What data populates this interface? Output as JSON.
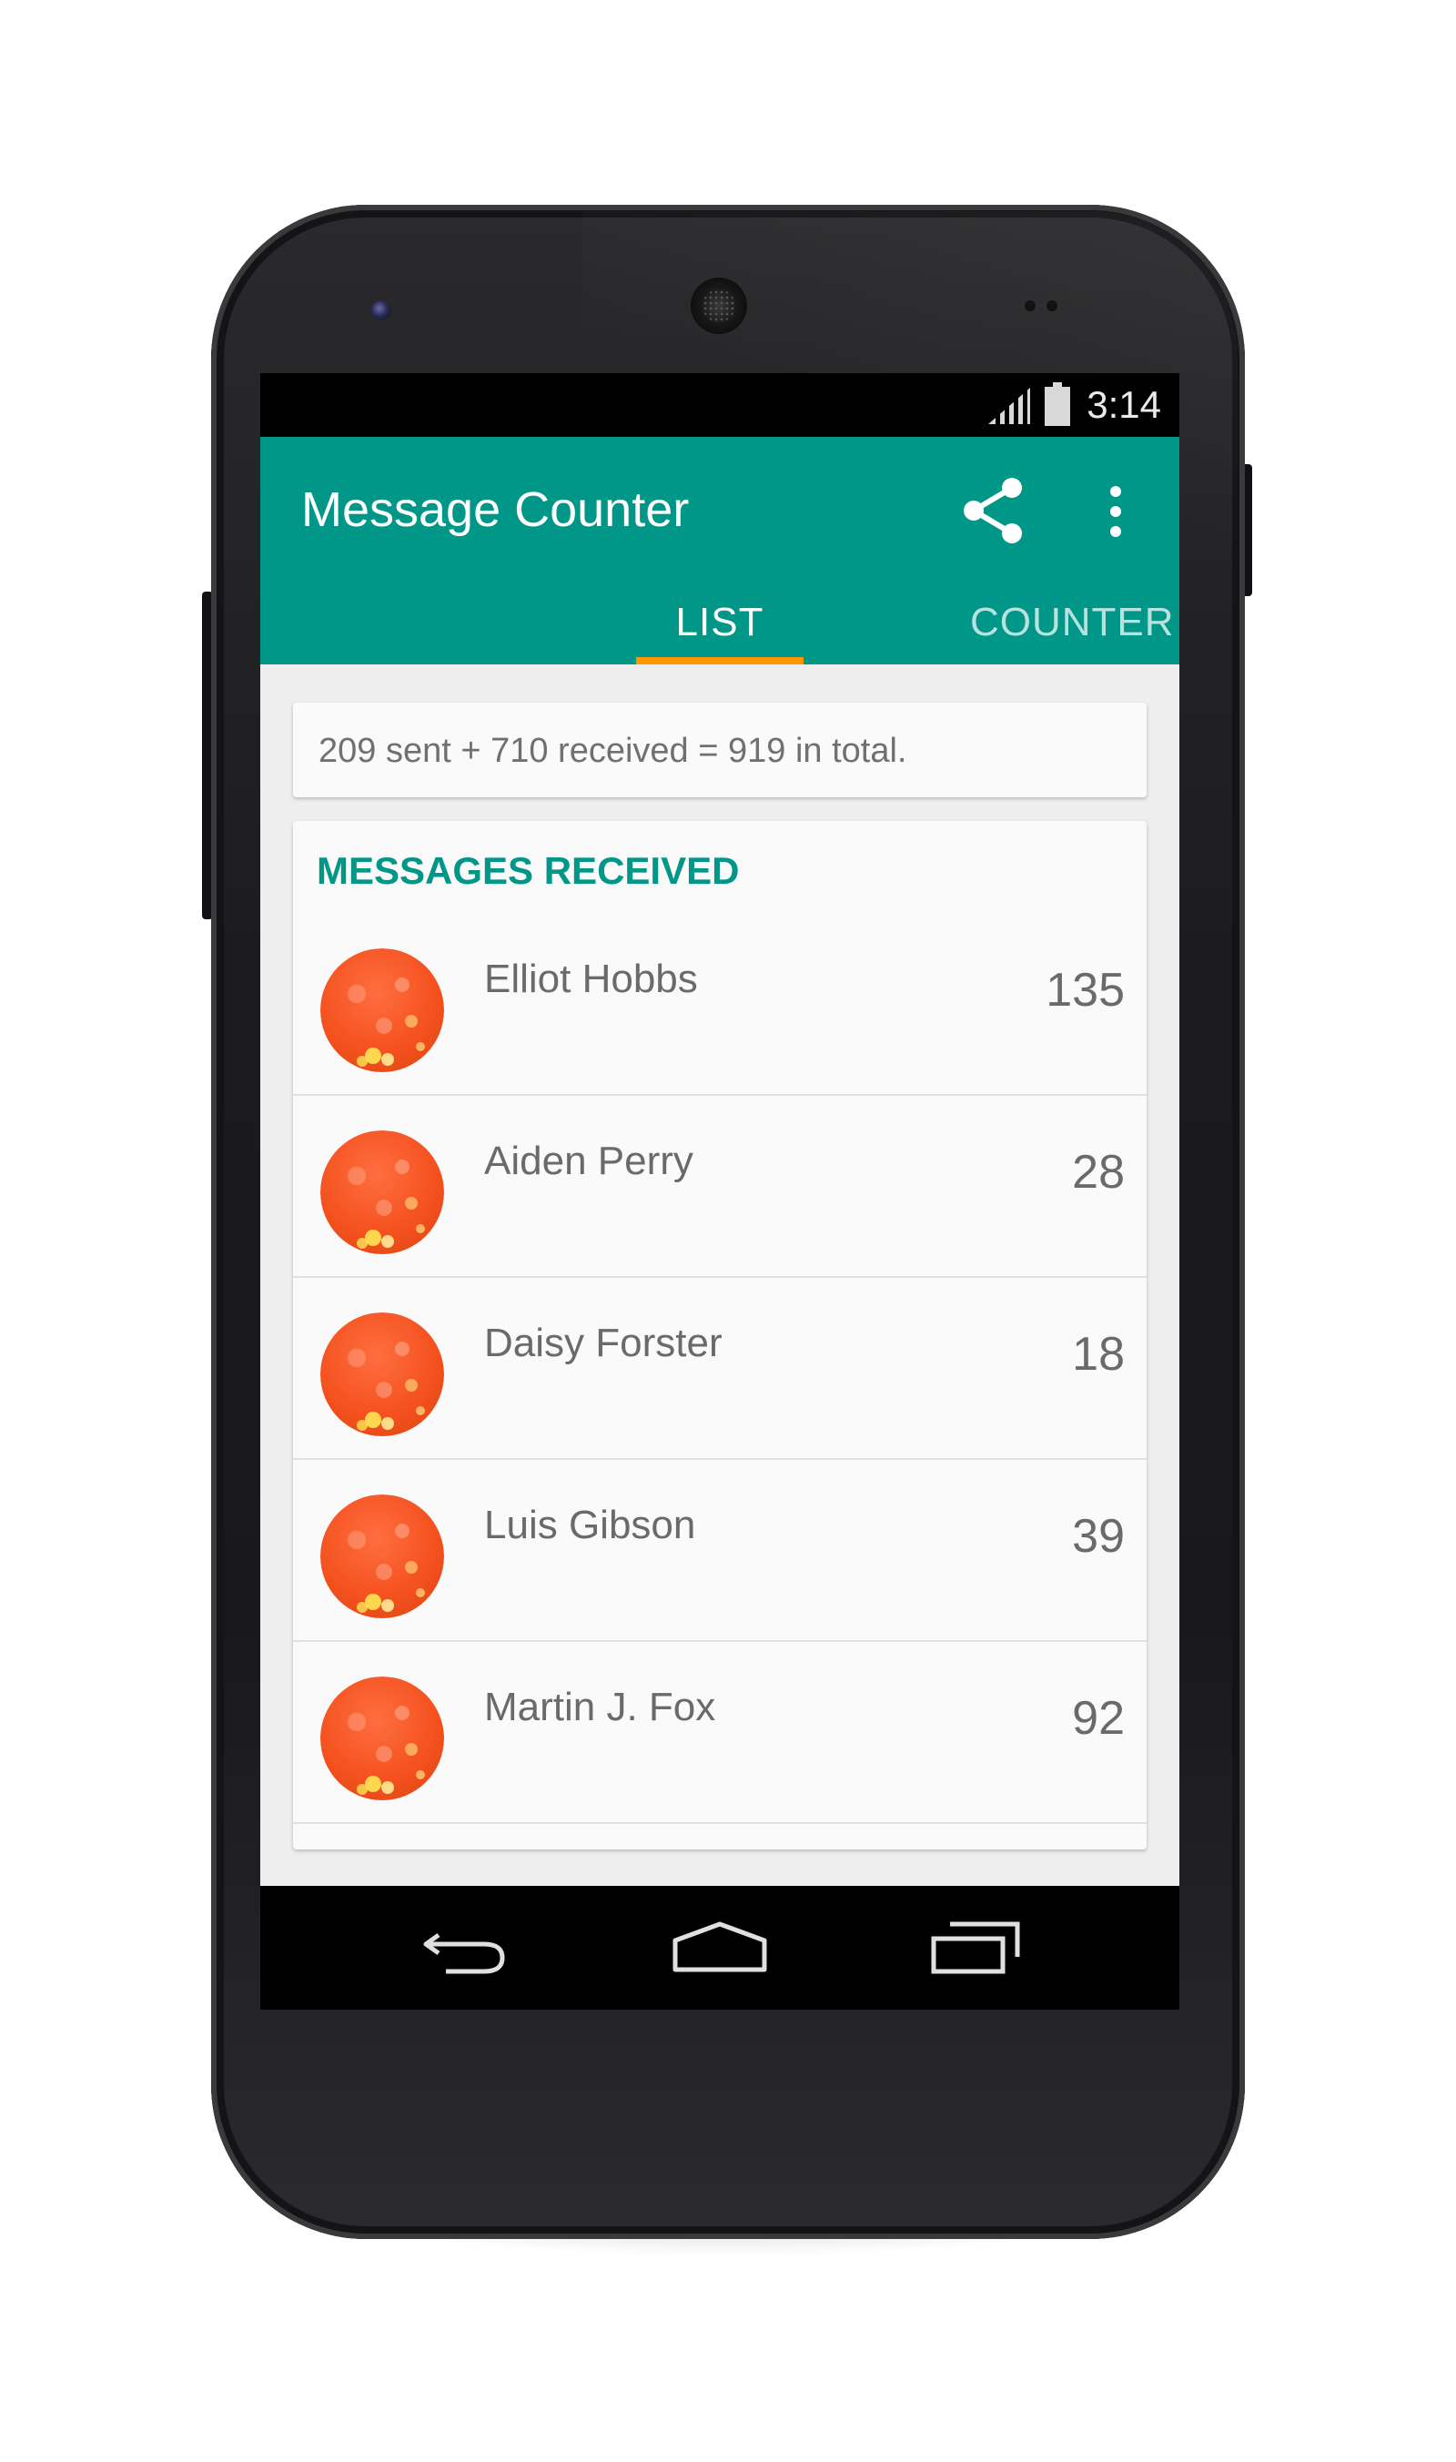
{
  "status_bar": {
    "time": "3:14"
  },
  "app_bar": {
    "title": "Message Counter",
    "color": "#009688",
    "actions": [
      "share-icon",
      "overflow-icon"
    ]
  },
  "tabs": [
    {
      "label": "LIST",
      "selected": true
    },
    {
      "label": "COUNTER",
      "selected": false
    }
  ],
  "tab_indicator_color": "#ff9800",
  "summary": {
    "text": "209 sent + 710 received = 919 in total."
  },
  "messages_received": {
    "header": "MESSAGES RECEIVED",
    "rows": [
      {
        "name": "Elliot Hobbs",
        "count": "135"
      },
      {
        "name": "Aiden Perry",
        "count": "28"
      },
      {
        "name": "Daisy Forster",
        "count": "18"
      },
      {
        "name": "Luis Gibson",
        "count": "39"
      },
      {
        "name": "Martin J. Fox",
        "count": "92"
      }
    ]
  },
  "nav_bar": {
    "buttons": [
      "back-icon",
      "home-icon",
      "recents-icon"
    ]
  }
}
